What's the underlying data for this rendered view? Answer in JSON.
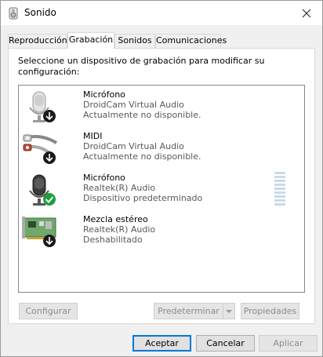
{
  "window": {
    "title": "Sonido"
  },
  "tabs": [
    {
      "label": "Reproducción",
      "active": false
    },
    {
      "label": "Grabación",
      "active": true
    },
    {
      "label": "Sonidos",
      "active": false
    },
    {
      "label": "Comunicaciones",
      "active": false
    }
  ],
  "instruction": "Seleccione un dispositivo de grabación para modificar su configuración:",
  "devices": [
    {
      "name": "Micrófono",
      "driver": "DroidCam Virtual Audio",
      "status": "Actualmente no disponible.",
      "icon": "microphone-icon",
      "badge": "down-arrow"
    },
    {
      "name": "MIDI",
      "driver": "DroidCam Virtual Audio",
      "status": "Actualmente no disponible.",
      "icon": "midi-cable-icon",
      "badge": "down-arrow"
    },
    {
      "name": "Micrófono",
      "driver": "Realtek(R) Audio",
      "status": "Dispositivo predeterminado",
      "icon": "microphone-icon",
      "badge": "default-check"
    },
    {
      "name": "Mezcla estéreo",
      "driver": "Realtek(R) Audio",
      "status": "Deshabilitado",
      "icon": "sound-card-icon",
      "badge": "down-arrow"
    }
  ],
  "buttons": {
    "configure": "Configurar",
    "set_default": "Predeterminar",
    "properties": "Propiedades",
    "accept": "Aceptar",
    "cancel": "Cancelar",
    "apply": "Aplicar"
  },
  "colors": {
    "accent": "#0078d7",
    "check": "#1e9e3c",
    "meter": "#c8dbe6"
  }
}
